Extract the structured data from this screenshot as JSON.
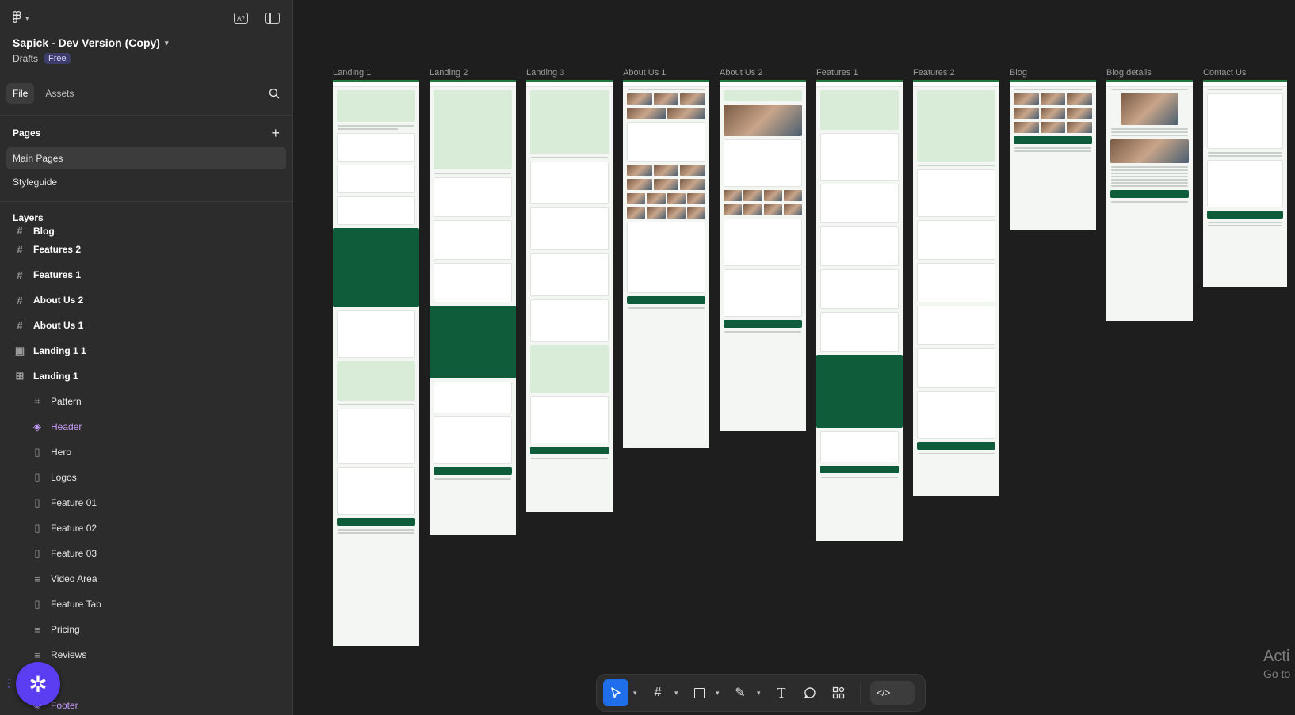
{
  "sidebar": {
    "file_title": "Sapick - Dev Version (Copy)",
    "location": "Drafts",
    "plan_badge": "Free",
    "tabs": {
      "file": "File",
      "assets": "Assets"
    },
    "pages_heading": "Pages",
    "pages": [
      "Main Pages",
      "Styleguide"
    ],
    "layers_heading": "Layers",
    "layers_top": [
      {
        "label": "Blog",
        "glyph": "#"
      },
      {
        "label": "Features 2",
        "glyph": "#"
      },
      {
        "label": "Features 1",
        "glyph": "#"
      },
      {
        "label": "About Us 2",
        "glyph": "#"
      },
      {
        "label": "About Us 1",
        "glyph": "#"
      },
      {
        "label": "Landing 1 1",
        "glyph": "▣"
      },
      {
        "label": "Landing 1",
        "glyph": "⊞"
      }
    ],
    "layers_children": [
      {
        "label": "Pattern",
        "glyph": "⌗"
      },
      {
        "label": "Header",
        "glyph": "◈"
      },
      {
        "label": "Hero",
        "glyph": "▯"
      },
      {
        "label": "Logos",
        "glyph": "▯"
      },
      {
        "label": "Feature 01",
        "glyph": "▯"
      },
      {
        "label": "Feature 02",
        "glyph": "▯"
      },
      {
        "label": "Feature 03",
        "glyph": "▯"
      },
      {
        "label": "Video Area",
        "glyph": "≡"
      },
      {
        "label": "Feature Tab",
        "glyph": "▯"
      },
      {
        "label": "Pricing",
        "glyph": "≡"
      },
      {
        "label": "Reviews",
        "glyph": "≡"
      },
      {
        "label": "Q",
        "glyph": "≡"
      },
      {
        "label": "Footer",
        "glyph": "◈"
      }
    ]
  },
  "canvas": {
    "frames": [
      {
        "label": "Landing 1"
      },
      {
        "label": "Landing 2"
      },
      {
        "label": "Landing 3"
      },
      {
        "label": "About Us 1"
      },
      {
        "label": "About Us 2"
      },
      {
        "label": "Features 1"
      },
      {
        "label": "Features 2"
      },
      {
        "label": "Blog"
      },
      {
        "label": "Blog details"
      },
      {
        "label": "Contact Us"
      }
    ]
  },
  "toolbar": {
    "move_icon": "cursor-icon",
    "frame_icon": "hash-icon",
    "shape_icon": "square-icon",
    "pen_icon": "pen-icon",
    "text_label": "T",
    "comment_icon": "comment-icon",
    "actions_icon": "apps-icon",
    "dev_label": "</>"
  },
  "watermark": {
    "line1": "Acti",
    "line2": "Go to"
  },
  "colors": {
    "accent": "#1f6feb",
    "brand_green": "#0f5c3a",
    "purple": "#c59cf5"
  }
}
